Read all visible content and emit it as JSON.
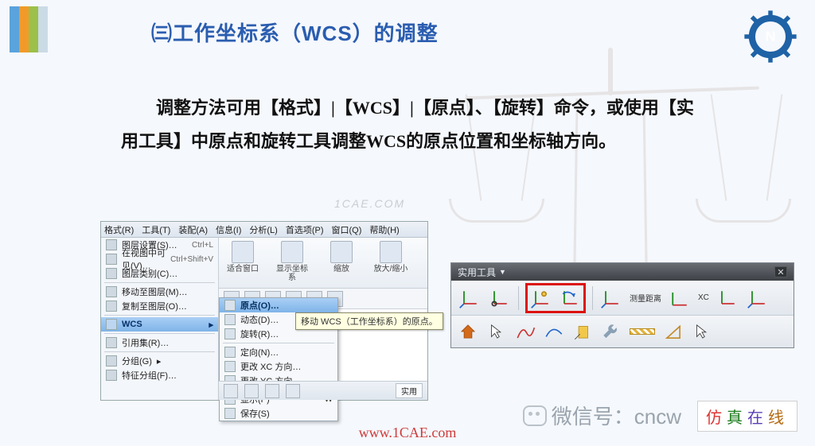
{
  "title": "㈢工作坐标系（WCS）的调整",
  "body_text": "调整方法可用【格式】|【WCS】|【原点】、【旋转】命令，或使用【实用工具】中原点和旋转工具调整WCS的原点位置和坐标轴方向。",
  "watermark_center": "1CAE.COM",
  "footer_url": "www.1CAE.com",
  "wechat_label": "微信号：cncw",
  "badge_chars": [
    "仿",
    "真",
    "在",
    "线"
  ],
  "panel_left": {
    "menu_bar": [
      "格式(R)",
      "工具(T)",
      "装配(A)",
      "信息(I)",
      "分析(L)",
      "首选项(P)",
      "窗口(Q)",
      "帮助(H)"
    ],
    "left_items_top": [
      {
        "label": "图层设置(S)…",
        "shortcut": "Ctrl+L"
      },
      {
        "label": "在视图中可见(V)…",
        "shortcut": "Ctrl+Shift+V"
      },
      {
        "label": "图层类别(C)…",
        "shortcut": ""
      }
    ],
    "left_items_mid": [
      {
        "label": "移动至图层(M)…"
      },
      {
        "label": "复制至图层(O)…"
      }
    ],
    "wcs_label": "WCS",
    "left_items_bot": [
      {
        "label": "引用集(R)…"
      },
      {
        "label": "分组(G)"
      },
      {
        "label": "特征分组(F)…"
      }
    ],
    "toolbar_buttons": [
      "适合窗口",
      "显示坐标系",
      "缩放",
      "放大/缩小"
    ],
    "submenu": [
      {
        "label": "原点(O)…",
        "highlight": true
      },
      {
        "label": "动态(D)…"
      },
      {
        "label": "旋转(R)…"
      },
      {
        "sep": true
      },
      {
        "label": "定向(N)…"
      },
      {
        "label": "更改 XC 方向…"
      },
      {
        "label": "更改 YC 方向…"
      },
      {
        "sep": true
      },
      {
        "label": "显示(P)",
        "shortcut": "W"
      },
      {
        "label": "保存(S)"
      }
    ],
    "tooltip": "移动 WCS（工作坐标系）的原点。",
    "bottom_tab": "实用"
  },
  "panel_right": {
    "title": "实用工具",
    "labels": {
      "measure": "测量距离",
      "xc": "XC"
    }
  }
}
